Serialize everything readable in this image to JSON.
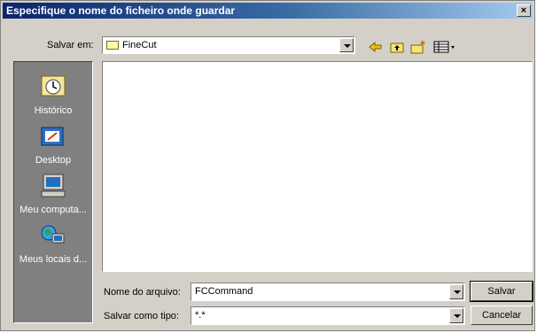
{
  "dialog": {
    "title": "Especifique o nome do ficheiro onde guardar",
    "close_label": "×"
  },
  "save_in": {
    "label": "Salvar em:",
    "value": "FineCut"
  },
  "toolbar": {
    "icons": [
      "back-arrow-icon",
      "up-folder-icon",
      "new-folder-icon",
      "view-menu-icon"
    ]
  },
  "places": [
    {
      "label": "Histórico",
      "icon": "history-icon"
    },
    {
      "label": "Desktop",
      "icon": "desktop-icon"
    },
    {
      "label": "Meu computa...",
      "icon": "my-computer-icon"
    },
    {
      "label": "Meus locais d...",
      "icon": "network-places-icon"
    }
  ],
  "file_name": {
    "label": "Nome do arquivo:",
    "value": "FCCommand"
  },
  "file_type": {
    "label": "Salvar como tipo:",
    "value": "*.*"
  },
  "buttons": {
    "save": "Salvar",
    "cancel": "Cancelar"
  }
}
